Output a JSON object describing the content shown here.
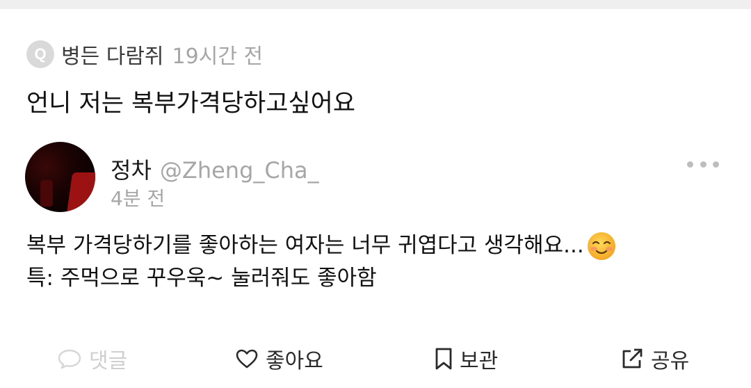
{
  "question": {
    "badge_letter": "Q",
    "asker_name": "병든 다람쥐",
    "asked_time": "19시간 전",
    "text": "언니 저는 복부가격당하고싶어요"
  },
  "answer": {
    "author_name": "정차",
    "author_handle": "@Zheng_Cha_",
    "posted_time": "4분 전",
    "lines": [
      "복부 가격당하기를 좋아하는 여자는 너무 귀엽다고 생각해요...",
      "특: 주먹으로 꾸우욱~ 눌러줘도 좋아함"
    ],
    "emoji": "smiling-face-with-blush"
  },
  "actions": {
    "comment_label": "댓글",
    "like_label": "좋아요",
    "save_label": "보관",
    "share_label": "공유"
  },
  "colors": {
    "muted_text": "#a6a6a6",
    "disabled_action": "#cfcfcf",
    "avatar_dark": "#1a0303",
    "avatar_red": "#9c1212"
  }
}
